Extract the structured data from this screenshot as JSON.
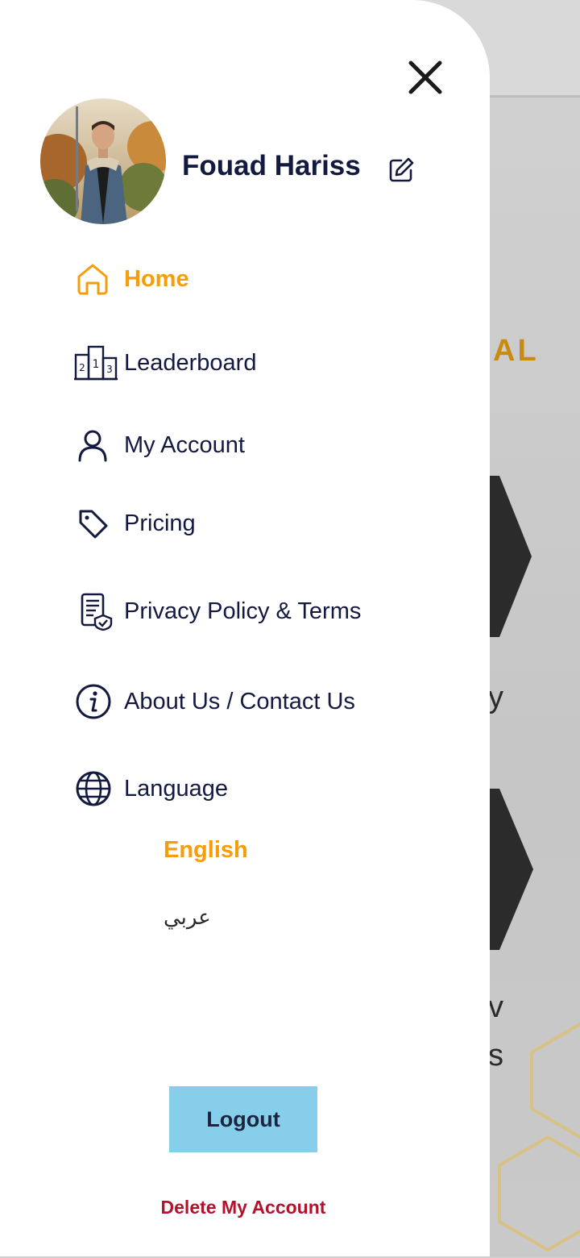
{
  "user": {
    "name": "Fouad Hariss"
  },
  "menu": {
    "home": "Home",
    "leaderboard": "Leaderboard",
    "my_account": "My Account",
    "pricing": "Pricing",
    "privacy": "Privacy Policy & Terms",
    "about": "About Us / Contact Us",
    "language": "Language"
  },
  "language_options": {
    "english": "English",
    "arabic": "عربي"
  },
  "actions": {
    "logout": "Logout",
    "delete_account": "Delete My Account"
  },
  "background": {
    "heading_fragment": "AL",
    "text_a": "y",
    "text_b": "v",
    "text_c": "s"
  },
  "colors": {
    "accent": "#f79d0c",
    "navy": "#13193f",
    "logout_bg": "#87ceeb",
    "danger": "#b3122b"
  },
  "icons": {
    "close": "close-icon",
    "edit": "edit-icon",
    "home": "home-icon",
    "leaderboard": "podium-icon",
    "account": "user-icon",
    "pricing": "tag-icon",
    "privacy": "document-shield-icon",
    "about": "info-icon",
    "language": "globe-icon"
  }
}
